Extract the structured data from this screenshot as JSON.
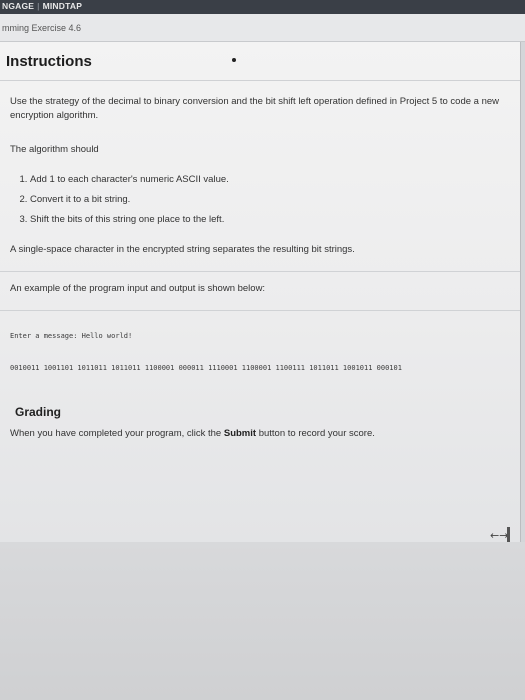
{
  "topbar": {
    "brand_left": "NGAGE",
    "brand_right": "MINDTAP"
  },
  "header": {
    "exercise_title": "mming Exercise 4.6"
  },
  "panel": {
    "title": "Instructions",
    "intro": "Use the strategy of the decimal to binary conversion and the bit shift left operation defined in Project 5 to code a new encryption algorithm.",
    "algorithm_lead": "The algorithm should",
    "steps": [
      "Add 1 to each character's numeric ASCII value.",
      "Convert it to a bit string.",
      "Shift the bits of this string one place to the left."
    ],
    "separator_note": "A single-space character in the encrypted string separates the resulting bit strings.",
    "example_lead": "An example of the program input and output is shown below:",
    "example_input": "Enter a message: Hello world!",
    "example_output": "0010011 1001101 1011011 1011011 1100001 000011 1110001 1100001 1100111 1011011 1001011 000101",
    "grading_title": "Grading",
    "grading_pre": "When you have completed your program, click the ",
    "grading_bold": "Submit",
    "grading_post": " button to record your score."
  },
  "controls": {
    "resize_glyph": "←→"
  }
}
